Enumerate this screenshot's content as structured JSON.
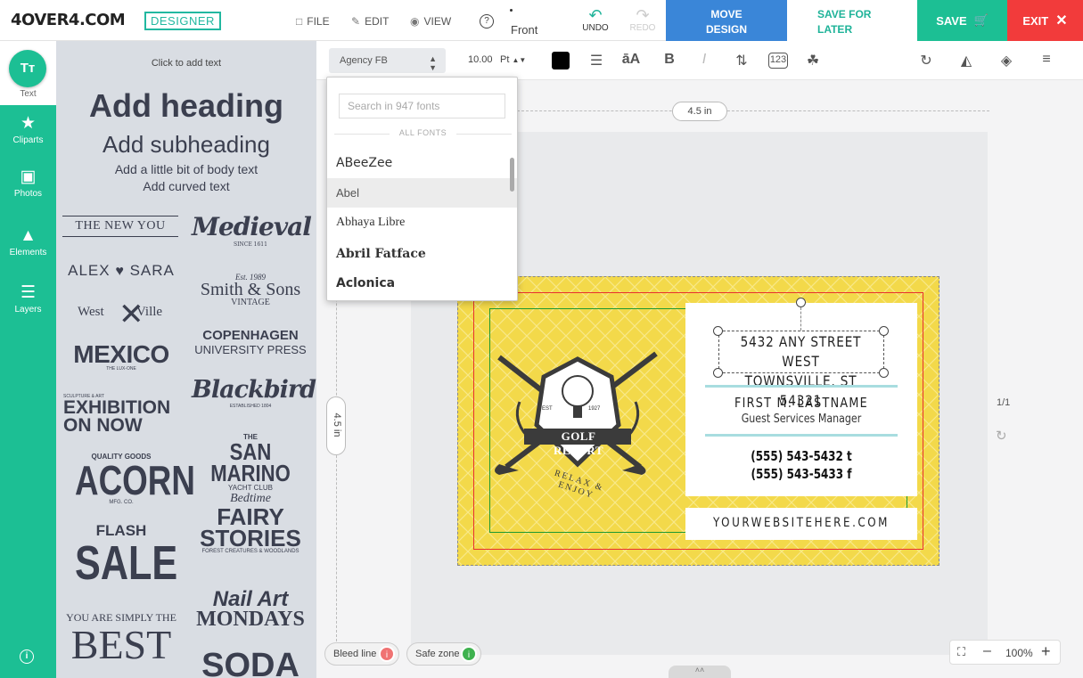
{
  "header": {
    "logo": "4OVER4.COM",
    "badge": "DESIGNER",
    "menu": {
      "file": "FILE",
      "edit": "EDIT",
      "view": "VIEW"
    },
    "help": "?",
    "side_label": "Front",
    "undo": "UNDO",
    "redo": "REDO",
    "move_design_l1": "MOVE",
    "move_design_l2": "DESIGN",
    "save_later_l1": "SAVE FOR",
    "save_later_l2": "LATER",
    "save": "SAVE",
    "exit": "EXIT"
  },
  "rail": {
    "text_icon": "Tт",
    "text": "Text",
    "cliparts": "Cliparts",
    "photos": "Photos",
    "elements": "Elements",
    "layers": "Layers",
    "info": "i"
  },
  "text_panel": {
    "click_to_add": "Click to add text",
    "heading": "Add heading",
    "subheading": "Add subheading",
    "body": "Add a little bit of body text",
    "curved": "Add curved text",
    "templates": {
      "new_you": "THE NEW YOU",
      "alex": "ALEX",
      "sara": "SARA",
      "west": "West",
      "ville": "Ville",
      "mexico": "MEXICO",
      "mexico_sub": "THE LUX-ONE",
      "exhibition_top": "SCULPTURE & ART",
      "exhibition": "EXHIBITION",
      "on_now": "ON NOW",
      "quality": "QUALITY GOODS",
      "acorn": "ACORN",
      "acorn_sub": "MFG. CO.",
      "flash": "FLASH",
      "sale": "SALE",
      "simply": "YOU ARE SIMPLY THE",
      "best": "BEST",
      "medieval": "Medieval",
      "medieval_since": "SINCE 1611",
      "est": "Est. 1989",
      "smith": "Smith & Sons",
      "vintage": "VINTAGE",
      "copenhagen": "COPENHAGEN",
      "university": "UNIVERSITY PRESS",
      "blackbird": "Blackbird",
      "established": "ESTABLISHED 1804",
      "the": "THE",
      "san_marino": "SAN MARINO",
      "yacht": "YACHT CLUB",
      "bedtime": "Bedtime",
      "fairy": "FAIRY",
      "stories": "STORIES",
      "forest": "FOREST CREATURES & WOODLANDS",
      "nail_art": "Nail Art",
      "mondays": "MONDAYS",
      "soda": "SODA"
    }
  },
  "toolbar": {
    "font": "Agency FB",
    "size": "10.00",
    "unit": "Pt",
    "text_color": "#000000"
  },
  "font_dropdown": {
    "search_placeholder": "Search in 947 fonts",
    "section": "ALL FONTS",
    "fonts": [
      "ABeeZee",
      "Abel",
      "Abhaya Libre",
      "Abril Fatface",
      "Aclonica"
    ],
    "highlighted": "Abel"
  },
  "canvas": {
    "width_label": "4.5 in",
    "height_label": "4.5 in",
    "page_count": "1/1",
    "card": {
      "address_line1": "5432 ANY STREET WEST",
      "address_line2": "TOWNSVILLE, ST 54321",
      "name": "FIRST M. LASTNAME",
      "title": "Guest Services Manager",
      "phone": "(555) 543-5432 t",
      "fax": "(555) 543-5433 f",
      "website": "YOURWEBSITEHERE.COM",
      "logo_text": "GOLF RESORT",
      "logo_est": "EST",
      "logo_year": "1927",
      "logo_tagline": "RELAX & ENJOY",
      "bg_color": "#f3d94a"
    },
    "bleed_label": "Bleed line",
    "safe_label": "Safe zone",
    "zoom": "100%"
  },
  "colors": {
    "accent": "#1cbf94",
    "move_blue": "#3a86d8",
    "exit_red": "#f23b3b",
    "bleed_red": "#e83030",
    "safe_green": "#1e9a32"
  }
}
